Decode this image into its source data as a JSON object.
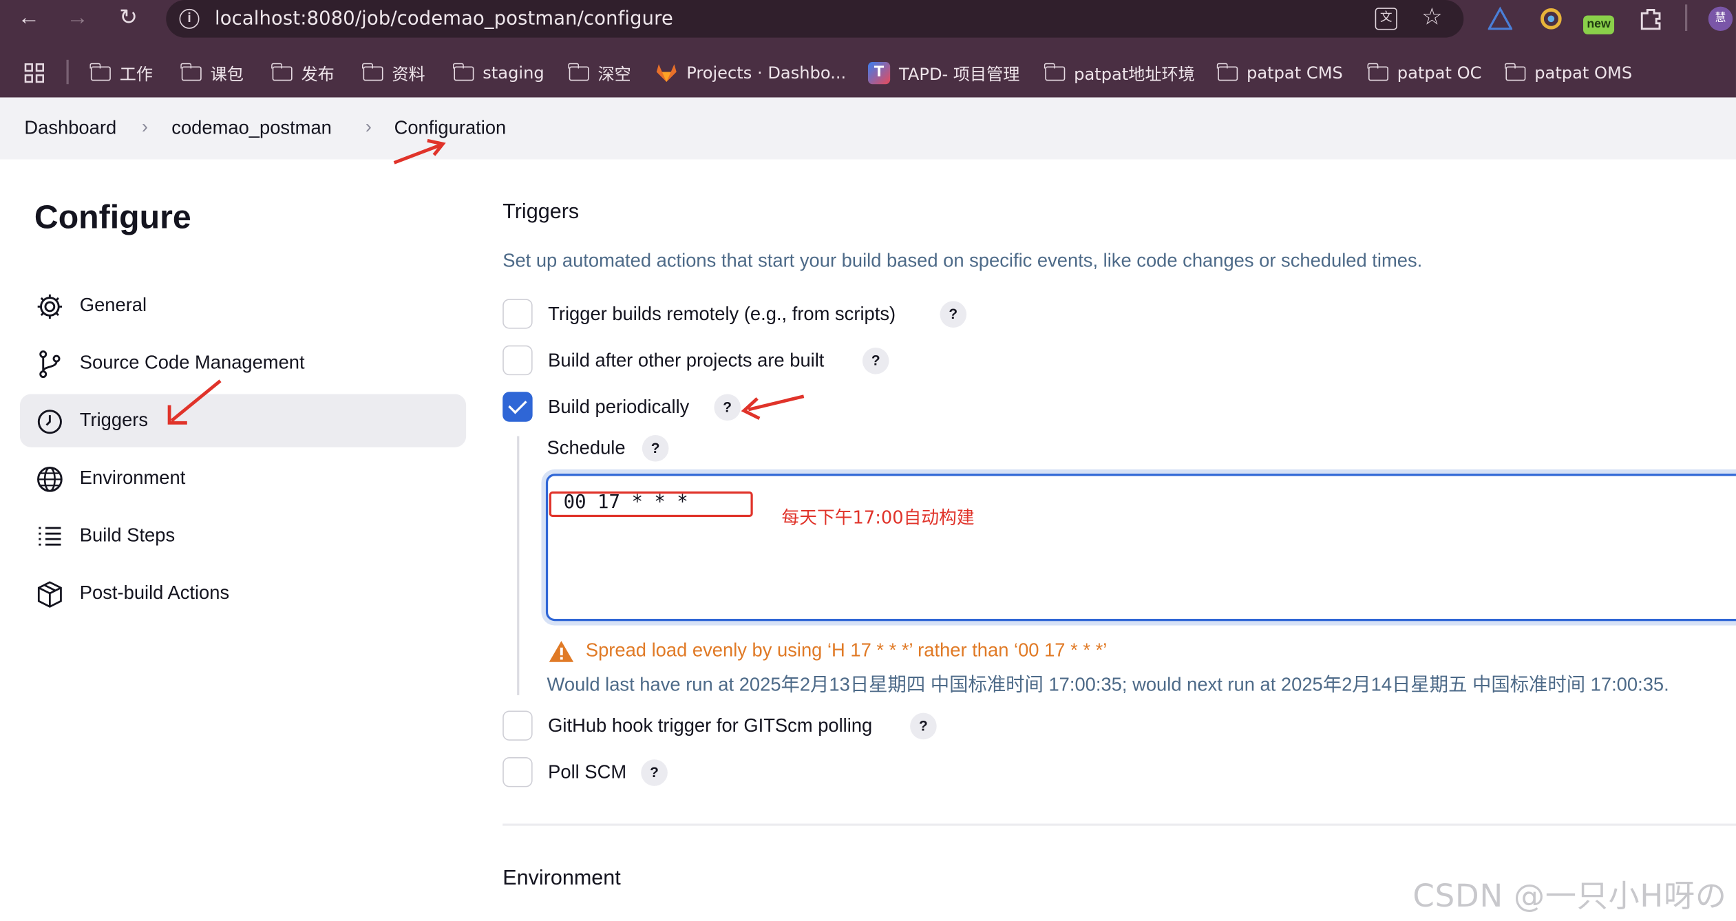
{
  "browser": {
    "url": "localhost:8080/job/codemao_postman/configure",
    "new_badge": "new",
    "profile_initial": "慧",
    "bookmarks": [
      "工作",
      "课包",
      "发布",
      "资料",
      "staging",
      "深空",
      "Projects · Dashbo...",
      "TAPD- 项目管理",
      "patpat地址环境",
      "patpat CMS",
      "patpat OC",
      "patpat OMS"
    ]
  },
  "breadcrumb": {
    "items": [
      "Dashboard",
      "codemao_postman",
      "Configuration"
    ]
  },
  "sidebar": {
    "title": "Configure",
    "items": [
      {
        "label": "General",
        "icon": "gear-icon"
      },
      {
        "label": "Source Code Management",
        "icon": "branch-icon"
      },
      {
        "label": "Triggers",
        "icon": "clock-icon",
        "active": true
      },
      {
        "label": "Environment",
        "icon": "globe-icon"
      },
      {
        "label": "Build Steps",
        "icon": "list-icon"
      },
      {
        "label": "Post-build Actions",
        "icon": "package-icon"
      }
    ]
  },
  "triggers": {
    "title": "Triggers",
    "description": "Set up automated actions that start your build based on specific events, like code changes or scheduled times.",
    "options": [
      {
        "label": "Trigger builds remotely (e.g., from scripts)",
        "checked": false
      },
      {
        "label": "Build after other projects are built",
        "checked": false
      },
      {
        "label": "Build periodically",
        "checked": true
      },
      {
        "label": "GitHub hook trigger for GITScm polling",
        "checked": false
      },
      {
        "label": "Poll SCM",
        "checked": false
      }
    ],
    "schedule": {
      "label": "Schedule",
      "value": "00 17 * * *",
      "warning": "Spread load evenly by using ‘H 17 * * *’ rather than ‘00 17 * * *’",
      "info": "Would last have run at 2025年2月13日星期四 中国标准时间 17:00:35; would next run at 2025年2月14日星期五 中国标准时间 17:00:35."
    },
    "help_label": "?"
  },
  "environment": {
    "title": "Environment"
  },
  "annotation": {
    "text": "每天下午17:00自动构建"
  },
  "watermark": "CSDN @一只小H呀の",
  "colors": {
    "chrome": "#4a2f43",
    "accent": "#2f66d6",
    "warning": "#e07a26",
    "annotation": "#e0332a"
  }
}
